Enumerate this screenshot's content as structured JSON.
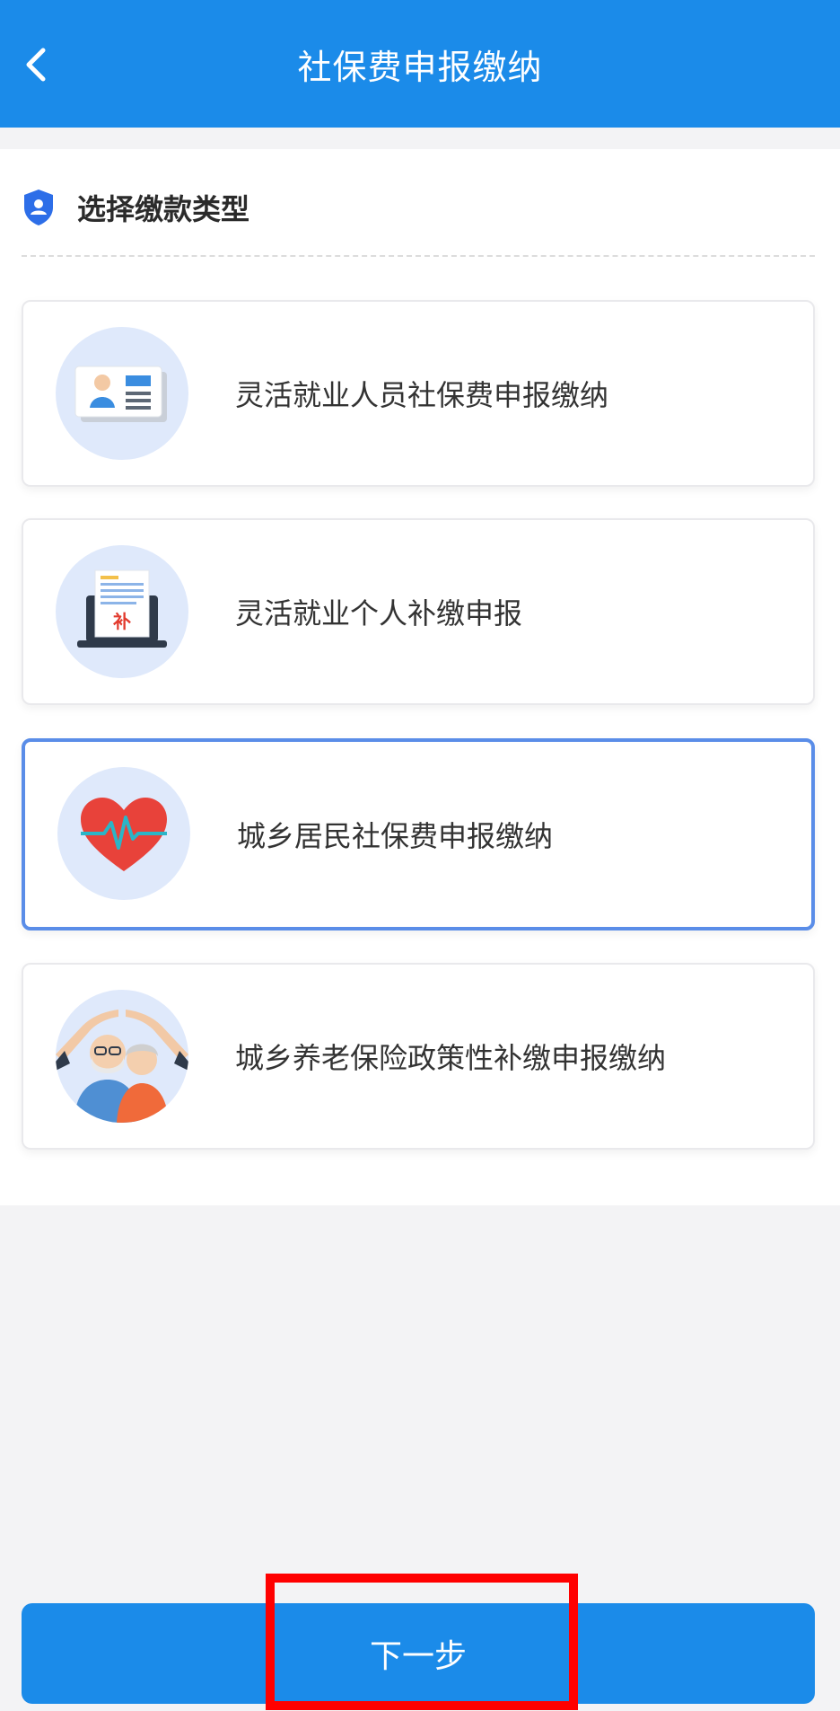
{
  "header": {
    "title": "社保费申报缴纳",
    "back_icon": "chevron-left-icon"
  },
  "section": {
    "title": "选择缴款类型",
    "icon": "shield-user-icon"
  },
  "options": [
    {
      "label": "灵活就业人员社保费申报缴纳",
      "icon": "id-card-icon",
      "selected": false
    },
    {
      "label": "灵活就业个人补缴申报",
      "icon": "laptop-document-icon",
      "icon_text": "补",
      "selected": false
    },
    {
      "label": "城乡居民社保费申报缴纳",
      "icon": "heart-pulse-icon",
      "selected": true
    },
    {
      "label": "城乡养老保险政策性补缴申报缴纳",
      "icon": "elderly-couple-icon",
      "selected": false
    }
  ],
  "footer": {
    "next_label": "下一步"
  },
  "colors": {
    "primary": "#1b8be9",
    "selected_border": "#5a8de8",
    "highlight": "#ff0000"
  }
}
